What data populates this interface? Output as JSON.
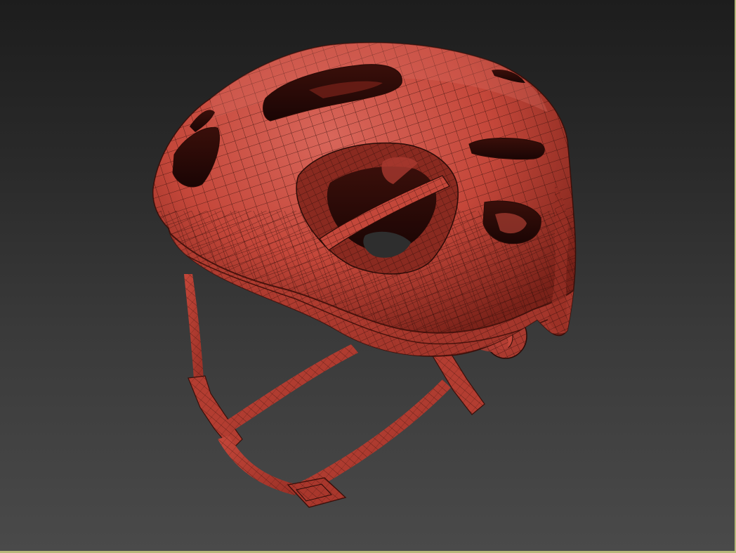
{
  "viewport": {
    "active_border_color": "#b8b87a",
    "background_top": "#1d1d1d",
    "background_bottom": "#4a4a4a"
  },
  "model": {
    "object": "bicycle-helmet",
    "display_mode": "smooth-shaded-with-wireframe-edges",
    "shell_color": "#c4473a",
    "shell_highlight_color": "#d8665a",
    "shell_shadow_color": "#7a2219",
    "wire_color": "#2a0b07"
  }
}
